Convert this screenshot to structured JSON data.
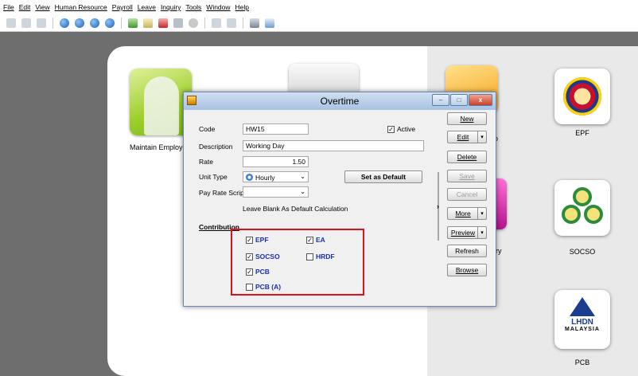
{
  "menu": [
    "File",
    "Edit",
    "View",
    "Human Resource",
    "Payroll",
    "Leave",
    "Inquiry",
    "Tools",
    "Window",
    "Help"
  ],
  "dashboard": {
    "maintain_label": "Maintain Employ",
    "label_o": "o",
    "label_y": "ry",
    "epf_label": "EPF",
    "socso_label": "SOCSO",
    "pcb_label": "PCB",
    "lhdn_text": "LHDN",
    "malaysia_text": "MALAYSIA"
  },
  "dialog": {
    "title": "Overtime",
    "code_label": "Code",
    "code_value": "HW15",
    "active_label": "Active",
    "active_checked": true,
    "description_label": "Description",
    "description_value": "Working Day",
    "rate_label": "Rate",
    "rate_value": "1.50",
    "unit_type_label": "Unit Type",
    "unit_type_value": "Hourly",
    "set_default_button": "Set as Default",
    "pay_rate_label": "Pay Rate Script",
    "pay_rate_value": "",
    "hint": "Leave Blank As Default Calculation",
    "contribution_label": "Contribution",
    "contributions": [
      {
        "label": "EPF",
        "checked": true
      },
      {
        "label": "EA",
        "checked": true
      },
      {
        "label": "SOCSO",
        "checked": true
      },
      {
        "label": "HRDF",
        "checked": false
      },
      {
        "label": "PCB",
        "checked": true
      },
      {
        "label": "PCB (A)",
        "checked": false
      }
    ],
    "buttons": {
      "new": "New",
      "edit": "Edit",
      "delete": "Delete",
      "save": "Save",
      "cancel": "Cancel",
      "more": "More",
      "preview": "Preview",
      "refresh": "Refresh",
      "browse": "Browse"
    },
    "chevron": "›"
  },
  "window_buttons": {
    "minimize": "–",
    "maximize": "□",
    "close": "x"
  }
}
